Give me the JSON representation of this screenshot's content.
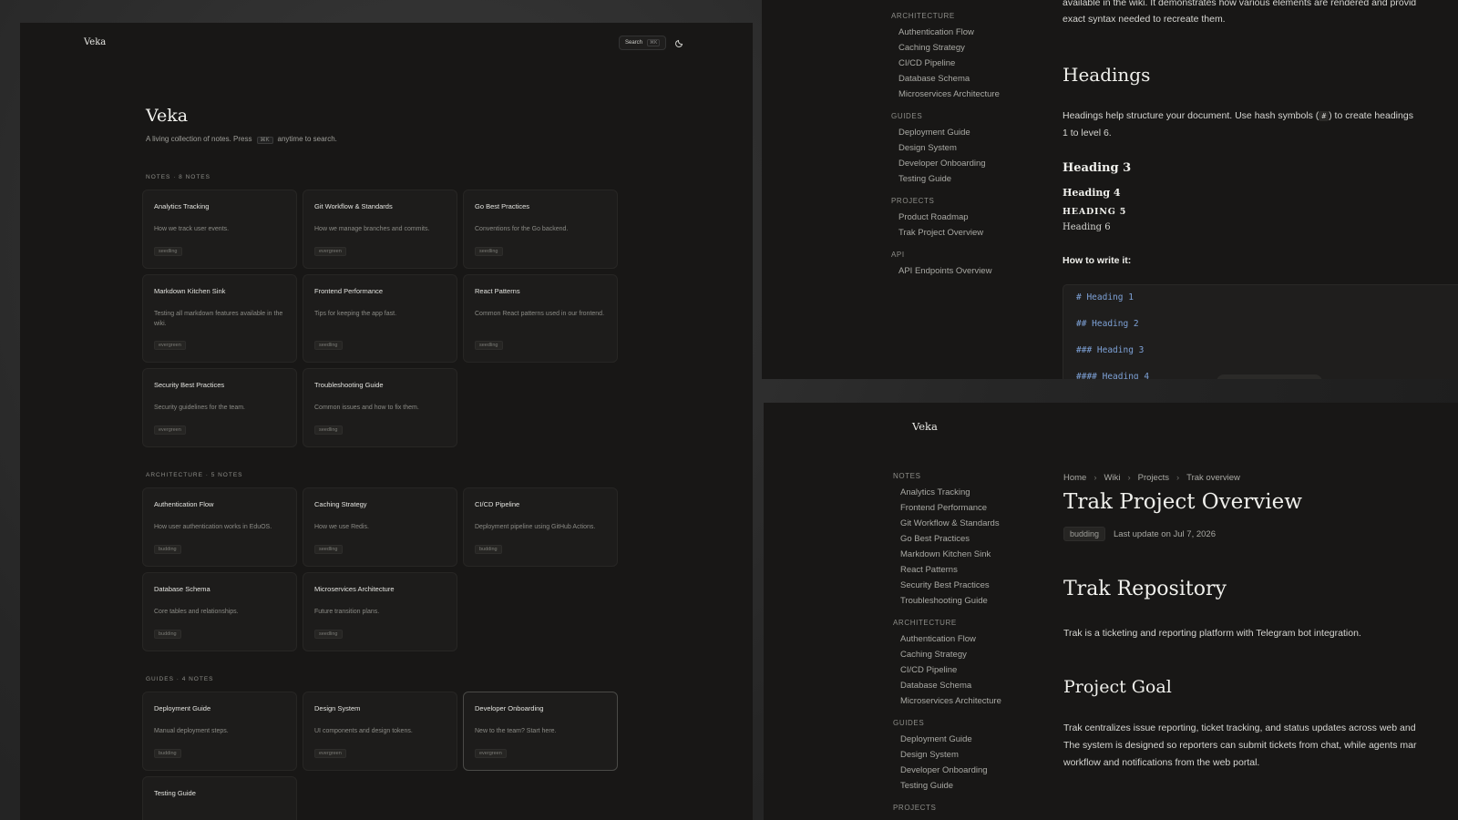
{
  "home": {
    "brand": "Veka",
    "search_label": "Search",
    "search_kbd": "⌘K",
    "title": "Veka",
    "intro_before": "A living collection of notes. Press",
    "intro_kbd": "⌘K",
    "intro_after": "anytime to search.",
    "sections": [
      {
        "label": "NOTES · 8 NOTES",
        "cards": [
          {
            "title": "Analytics Tracking",
            "desc": "How we track user events.",
            "tag": "seedling"
          },
          {
            "title": "Git Workflow & Standards",
            "desc": "How we manage branches and commits.",
            "tag": "evergreen"
          },
          {
            "title": "Go Best Practices",
            "desc": "Conventions for the Go backend.",
            "tag": "seedling"
          },
          {
            "title": "Markdown Kitchen Sink",
            "desc": "Testing all markdown features available in the wiki.",
            "tag": "evergreen"
          },
          {
            "title": "Frontend Performance",
            "desc": "Tips for keeping the app fast.",
            "tag": "seedling"
          },
          {
            "title": "React Patterns",
            "desc": "Common React patterns used in our frontend.",
            "tag": "seedling"
          },
          {
            "title": "Security Best Practices",
            "desc": "Security guidelines for the team.",
            "tag": "evergreen"
          },
          {
            "title": "Troubleshooting Guide",
            "desc": "Common issues and how to fix them.",
            "tag": "seedling"
          }
        ]
      },
      {
        "label": "ARCHITECTURE · 5 NOTES",
        "cards": [
          {
            "title": "Authentication Flow",
            "desc": "How user authentication works in EduOS.",
            "tag": "budding"
          },
          {
            "title": "Caching Strategy",
            "desc": "How we use Redis.",
            "tag": "seedling"
          },
          {
            "title": "CI/CD Pipeline",
            "desc": "Deployment pipeline using GitHub Actions.",
            "tag": "budding"
          },
          {
            "title": "Database Schema",
            "desc": "Core tables and relationships.",
            "tag": "budding"
          },
          {
            "title": "Microservices Architecture",
            "desc": "Future transition plans.",
            "tag": "seedling"
          }
        ]
      },
      {
        "label": "GUIDES · 4 NOTES",
        "cards": [
          {
            "title": "Deployment Guide",
            "desc": "Manual deployment steps.",
            "tag": "budding"
          },
          {
            "title": "Design System",
            "desc": "UI components and design tokens.",
            "tag": "evergreen"
          },
          {
            "title": "Developer Onboarding",
            "desc": "New to the team? Start here.",
            "tag": "evergreen"
          },
          {
            "title": "Testing Guide",
            "desc": "",
            "tag": ""
          }
        ]
      }
    ]
  },
  "headings_doc": {
    "lead": [
      "available in the wiki. It demonstrates how various elements are rendered and provid",
      "exact syntax needed to recreate them."
    ],
    "sidebar": [
      {
        "cat": "ARCHITECTURE",
        "items": [
          "Authentication Flow",
          "Caching Strategy",
          "CI/CD Pipeline",
          "Database Schema",
          "Microservices Architecture"
        ]
      },
      {
        "cat": "GUIDES",
        "items": [
          "Deployment Guide",
          "Design System",
          "Developer Onboarding",
          "Testing Guide"
        ]
      },
      {
        "cat": "PROJECTS",
        "items": [
          "Product Roadmap",
          "Trak Project Overview"
        ]
      },
      {
        "cat": "API",
        "items": [
          "API Endpoints Overview"
        ]
      }
    ],
    "heading": "Headings",
    "para_before": "Headings help structure your document. Use hash symbols (",
    "para_code": "#",
    "para_after": ") to create headings",
    "para_line2": "1 to level 6.",
    "h3": "Heading 3",
    "h4": "Heading 4",
    "h5": "HEADING 5",
    "h6": "Heading 6",
    "how": "How to write it:",
    "code_lines": [
      "# Heading 1",
      "## Heading 2",
      "### Heading 3",
      "#### Heading 4"
    ]
  },
  "project_doc": {
    "brand": "Veka",
    "sidebar": [
      {
        "cat": "NOTES",
        "items": [
          "Analytics Tracking",
          "Frontend Performance",
          "Git Workflow & Standards",
          "Go Best Practices",
          "Markdown Kitchen Sink",
          "React Patterns",
          "Security Best Practices",
          "Troubleshooting Guide"
        ]
      },
      {
        "cat": "ARCHITECTURE",
        "items": [
          "Authentication Flow",
          "Caching Strategy",
          "CI/CD Pipeline",
          "Database Schema",
          "Microservices Architecture"
        ]
      },
      {
        "cat": "GUIDES",
        "items": [
          "Deployment Guide",
          "Design System",
          "Developer Onboarding",
          "Testing Guide"
        ]
      },
      {
        "cat": "PROJECTS",
        "items": []
      }
    ],
    "breadcrumbs": [
      "Home",
      "Wiki",
      "Projects",
      "Trak overview"
    ],
    "title": "Trak Project Overview",
    "status": "budding",
    "updated": "Last update on Jul 7, 2026",
    "h_repo": "Trak Repository",
    "p_repo": "Trak is a ticketing and reporting platform with Telegram bot integration.",
    "h_goal": "Project Goal",
    "p_goal": [
      "Trak centralizes issue reporting, ticket tracking, and status updates across web and",
      "The system is designed so reporters can submit tickets from chat, while agents mar",
      "workflow and notifications from the web portal."
    ]
  }
}
